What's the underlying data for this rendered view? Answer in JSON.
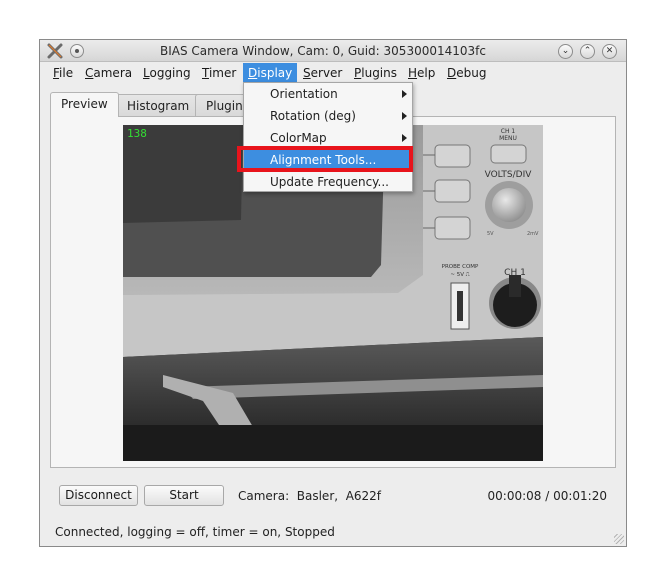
{
  "window": {
    "title": "BIAS Camera Window, Cam: 0, Guid: 305300014103fc"
  },
  "menubar": {
    "items": [
      {
        "mnemonic": "F",
        "rest": "ile"
      },
      {
        "mnemonic": "C",
        "rest": "amera"
      },
      {
        "mnemonic": "L",
        "rest": "ogging"
      },
      {
        "mnemonic": "T",
        "rest": "imer"
      },
      {
        "mnemonic": "D",
        "rest": "isplay"
      },
      {
        "mnemonic": "S",
        "rest": "erver"
      },
      {
        "mnemonic": "P",
        "rest": "lugins"
      },
      {
        "mnemonic": "H",
        "rest": "elp"
      },
      {
        "mnemonic": "D",
        "rest": "ebug"
      }
    ],
    "active_menu": "Display"
  },
  "display_menu": {
    "items": [
      {
        "label": "Orientation",
        "submenu": true
      },
      {
        "label": "Rotation (deg)",
        "submenu": true
      },
      {
        "label": "ColorMap",
        "submenu": true
      },
      {
        "label": "Alignment Tools...",
        "submenu": false
      },
      {
        "label": "Update Frequency...",
        "submenu": false
      }
    ],
    "highlighted": "Alignment Tools..."
  },
  "tabs": [
    {
      "label": "Preview"
    },
    {
      "label": "Histogram"
    },
    {
      "label": "Plugin"
    }
  ],
  "selected_tab": "Preview",
  "preview": {
    "frame_counter": "138",
    "image_text": {
      "ch1_menu_line1": "CH 1",
      "ch1_menu_line2": "MENU",
      "volts_div": "VOLTS/DIV",
      "probe_comp_line1": "PROBE COMP",
      "probe_comp_line2": "~ 5V ⎍",
      "ch1": "CH 1",
      "scale_5v": "5V",
      "scale_2mv": "2mV"
    }
  },
  "controls": {
    "disconnect_label": "Disconnect",
    "start_label": "Start",
    "camera_info": "Camera:  Basler,  A622f",
    "elapsed_time": "00:00:08 / 00:01:20"
  },
  "status": {
    "text": "Connected, logging = off, timer = on, Stopped"
  },
  "colors": {
    "accent": "#3d8ee0",
    "annotation_box": "#e8141c",
    "frame_counter": "#33dd33"
  }
}
